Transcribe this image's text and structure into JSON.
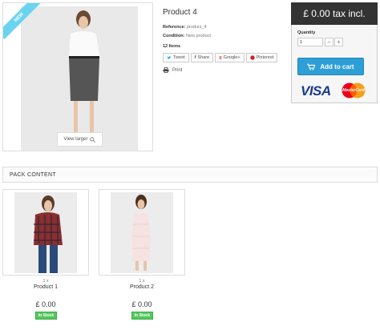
{
  "main_image": {
    "badge": "NEW",
    "view_larger_label": "View larger"
  },
  "product": {
    "title": "Product 4",
    "reference_label": "Reference:",
    "reference_value": "product_4",
    "condition_label": "Condition:",
    "condition_value": "New product",
    "items_count": "12 Items",
    "print_label": "Print"
  },
  "share": {
    "buttons": [
      {
        "label": "Tweet",
        "icon": "twitter-icon"
      },
      {
        "label": "Share",
        "icon": "facebook-icon"
      },
      {
        "label": "Google+",
        "icon": "google-plus-icon"
      },
      {
        "label": "Pinterest",
        "icon": "pinterest-icon"
      }
    ]
  },
  "buy_box": {
    "price": "£ 0.00 tax incl.",
    "quantity_label": "Quantity",
    "quantity_value": "1",
    "minus": "−",
    "plus": "+",
    "add_to_cart": "Add to cart",
    "payment_brands": [
      "VISA",
      "MasterCard"
    ]
  },
  "pack": {
    "heading": "PACK CONTENT",
    "items": [
      {
        "qty": "1 x",
        "name": "Product 1",
        "price": "£ 0.00",
        "stock": "In Stock"
      },
      {
        "qty": "1 x",
        "name": "Product 2",
        "price": "£ 0.00",
        "stock": "In Stock"
      }
    ]
  },
  "colors": {
    "accent": "#2e9fd6",
    "price_header": "#333333",
    "in_stock": "#55c65e",
    "new_badge": "#6ad4f0"
  }
}
